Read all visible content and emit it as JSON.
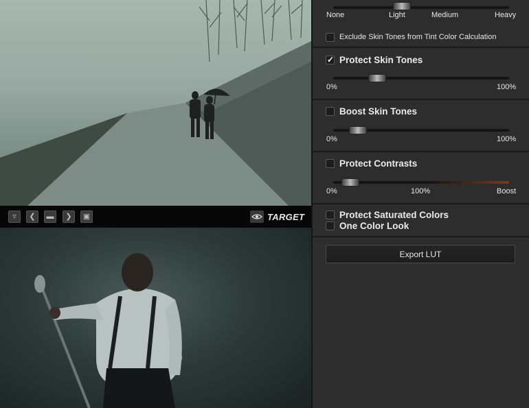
{
  "toolbar": {
    "buttons": [
      "save-preset-icon",
      "prev-icon",
      "folder-icon",
      "next-icon",
      "save-icon"
    ],
    "target_label": "TARGET"
  },
  "panel": {
    "tint_slider": {
      "labels": [
        "None",
        "Light",
        "Medium",
        "Heavy"
      ],
      "value_fraction": 0.38
    },
    "exclude_skin": {
      "label": "Exclude Skin Tones from Tint Color Calculation",
      "checked": false
    },
    "protect_skin": {
      "label": "Protect Skin Tones",
      "checked": true,
      "min_label": "0%",
      "max_label": "100%",
      "value_fraction": 0.22
    },
    "boost_skin": {
      "label": "Boost Skin Tones",
      "checked": false,
      "min_label": "0%",
      "max_label": "100%",
      "value_fraction": 0.1
    },
    "protect_contrasts": {
      "label": "Protect Contrasts",
      "checked": false,
      "min_label": "0%",
      "mid_label": "100%",
      "max_label": "Boost",
      "value_fraction": 0.05
    },
    "protect_saturated": {
      "label": "Protect Saturated Colors",
      "checked": false
    },
    "one_color_look": {
      "label": "One Color Look",
      "checked": false
    },
    "export_label": "Export LUT"
  }
}
